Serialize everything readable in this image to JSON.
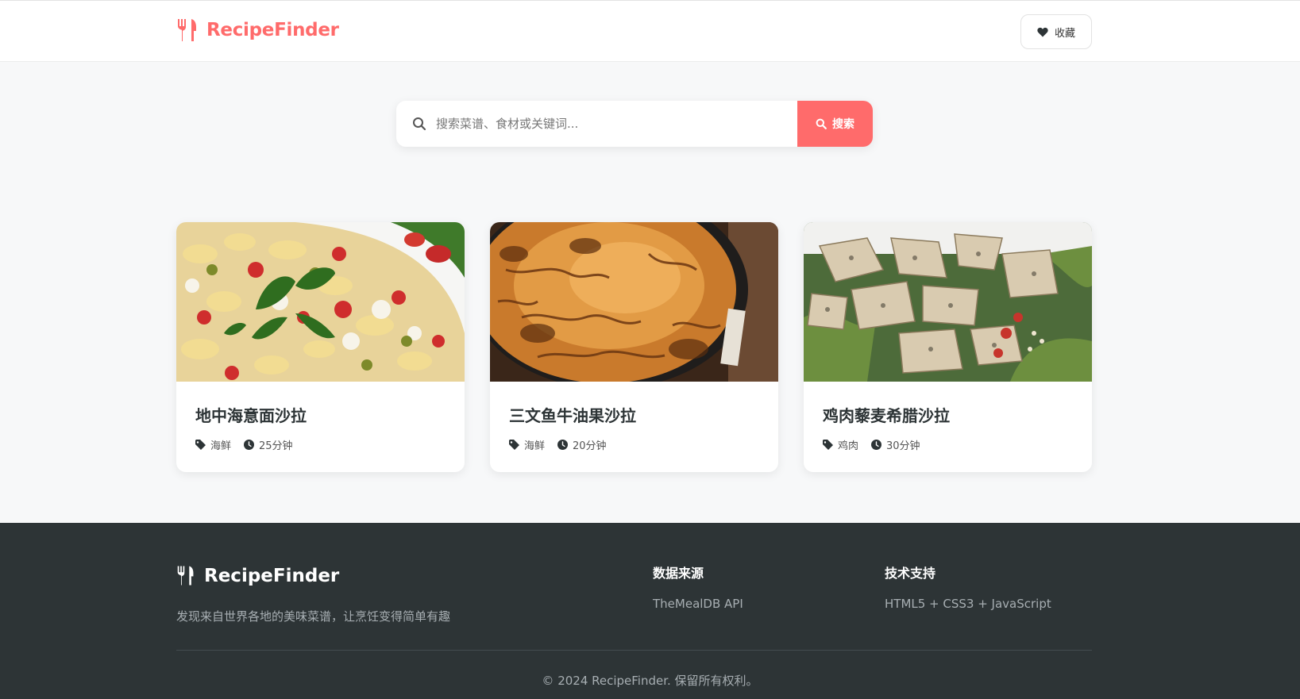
{
  "header": {
    "brand_name": "RecipeFinder",
    "brand_icon": "utensils-icon",
    "favorites_label": "收藏",
    "favorites_icon": "heart-icon"
  },
  "search": {
    "placeholder": "搜索菜谱、食材或关键词...",
    "value": "",
    "button_label": "搜索"
  },
  "recipes": [
    {
      "title": "地中海意面沙拉",
      "category": "海鲜",
      "time": "25分钟",
      "image": "pasta-salad"
    },
    {
      "title": "三文鱼牛油果沙拉",
      "category": "海鲜",
      "time": "20分钟",
      "image": "baked-pie"
    },
    {
      "title": "鸡肉藜麦希腊沙拉",
      "category": "鸡肉",
      "time": "30分钟",
      "image": "chicken-salad"
    }
  ],
  "footer": {
    "brand_name": "RecipeFinder",
    "tagline": "发现来自世界各地的美味菜谱，让烹饪变得简单有趣",
    "data_source_title": "数据来源",
    "data_source_text": "TheMealDB API",
    "tech_title": "技术支持",
    "tech_text": "HTML5 + CSS3 + JavaScript",
    "copyright": "© 2024 RecipeFinder. 保留所有权利。"
  },
  "colors": {
    "accent": "#ff6b6b",
    "footer_bg": "#2d3436",
    "page_bg": "#f7f8f9"
  }
}
